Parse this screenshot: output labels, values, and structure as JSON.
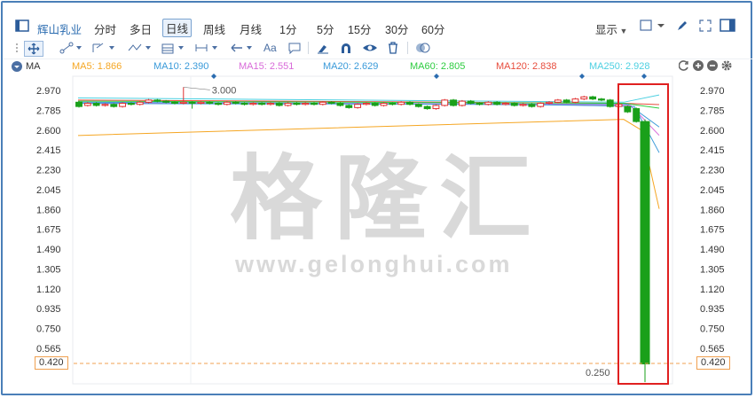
{
  "toolbar": {
    "stock_name": "辉山乳业",
    "periods": [
      "分时",
      "多日",
      "日线",
      "周线",
      "月线",
      "1分",
      "5分",
      "15分",
      "30分",
      "60分"
    ],
    "active_period": "日线",
    "display_label": "显示",
    "text_tool_label": "Aa"
  },
  "ma_bar": {
    "ma_label": "MA",
    "items": [
      {
        "label": "MA5: 1.866",
        "color": "#f5a623"
      },
      {
        "label": "MA10: 2.390",
        "color": "#3a9ad9"
      },
      {
        "label": "MA15: 2.551",
        "color": "#d96bd9"
      },
      {
        "label": "MA20: 2.629",
        "color": "#3a9ad9"
      },
      {
        "label": "MA60: 2.805",
        "color": "#2ecc40"
      },
      {
        "label": "MA120: 2.838",
        "color": "#e74c3c"
      },
      {
        "label": "MA250: 2.928",
        "color": "#4dd0e1"
      }
    ]
  },
  "watermark": {
    "brand": "格隆汇",
    "url": "www.gelonghui.com"
  },
  "chart_data": {
    "type": "candlestick",
    "y_ticks": [
      "2.970",
      "2.785",
      "2.600",
      "2.415",
      "2.230",
      "2.045",
      "1.860",
      "1.675",
      "1.490",
      "1.305",
      "1.120",
      "0.935",
      "0.750",
      "0.565"
    ],
    "ylim": [
      0.25,
      3.08
    ],
    "current_price": "0.420",
    "high_annotation": "3.000",
    "low_annotation": "0.250",
    "colors": {
      "up": "#e03030",
      "down": "#1aa01a"
    },
    "candles": [
      {
        "o": 2.86,
        "c": 2.82,
        "h": 2.87,
        "l": 2.81
      },
      {
        "o": 2.83,
        "c": 2.85,
        "h": 2.86,
        "l": 2.82
      },
      {
        "o": 2.85,
        "c": 2.83,
        "h": 2.86,
        "l": 2.82
      },
      {
        "o": 2.83,
        "c": 2.84,
        "h": 2.85,
        "l": 2.82
      },
      {
        "o": 2.84,
        "c": 2.82,
        "h": 2.85,
        "l": 2.81
      },
      {
        "o": 2.82,
        "c": 2.85,
        "h": 2.86,
        "l": 2.81
      },
      {
        "o": 2.85,
        "c": 2.84,
        "h": 2.86,
        "l": 2.83
      },
      {
        "o": 2.84,
        "c": 2.86,
        "h": 2.87,
        "l": 2.83
      },
      {
        "o": 2.86,
        "c": 2.88,
        "h": 2.89,
        "l": 2.85
      },
      {
        "o": 2.88,
        "c": 2.87,
        "h": 2.89,
        "l": 2.86
      },
      {
        "o": 2.87,
        "c": 2.86,
        "h": 2.88,
        "l": 2.85
      },
      {
        "o": 2.86,
        "c": 2.85,
        "h": 2.87,
        "l": 2.84
      },
      {
        "o": 2.85,
        "c": 2.86,
        "h": 3.0,
        "l": 2.84
      },
      {
        "o": 2.86,
        "c": 2.85,
        "h": 2.87,
        "l": 2.8
      },
      {
        "o": 2.85,
        "c": 2.86,
        "h": 2.87,
        "l": 2.84
      },
      {
        "o": 2.86,
        "c": 2.85,
        "h": 2.87,
        "l": 2.84
      },
      {
        "o": 2.85,
        "c": 2.84,
        "h": 2.86,
        "l": 2.83
      },
      {
        "o": 2.84,
        "c": 2.86,
        "h": 2.87,
        "l": 2.83
      },
      {
        "o": 2.86,
        "c": 2.85,
        "h": 2.87,
        "l": 2.84
      },
      {
        "o": 2.85,
        "c": 2.84,
        "h": 2.86,
        "l": 2.83
      },
      {
        "o": 2.84,
        "c": 2.85,
        "h": 2.86,
        "l": 2.83
      },
      {
        "o": 2.85,
        "c": 2.84,
        "h": 2.86,
        "l": 2.83
      },
      {
        "o": 2.84,
        "c": 2.85,
        "h": 2.86,
        "l": 2.83
      },
      {
        "o": 2.85,
        "c": 2.83,
        "h": 2.86,
        "l": 2.82
      },
      {
        "o": 2.83,
        "c": 2.85,
        "h": 2.86,
        "l": 2.82
      },
      {
        "o": 2.85,
        "c": 2.84,
        "h": 2.86,
        "l": 2.83
      },
      {
        "o": 2.84,
        "c": 2.85,
        "h": 2.86,
        "l": 2.83
      },
      {
        "o": 2.85,
        "c": 2.84,
        "h": 2.86,
        "l": 2.83
      },
      {
        "o": 2.84,
        "c": 2.86,
        "h": 2.87,
        "l": 2.83
      },
      {
        "o": 2.86,
        "c": 2.85,
        "h": 2.87,
        "l": 2.84
      },
      {
        "o": 2.85,
        "c": 2.83,
        "h": 2.86,
        "l": 2.82
      },
      {
        "o": 2.83,
        "c": 2.81,
        "h": 2.84,
        "l": 2.8
      },
      {
        "o": 2.81,
        "c": 2.84,
        "h": 2.85,
        "l": 2.8
      },
      {
        "o": 2.84,
        "c": 2.85,
        "h": 2.86,
        "l": 2.83
      },
      {
        "o": 2.85,
        "c": 2.83,
        "h": 2.86,
        "l": 2.82
      },
      {
        "o": 2.83,
        "c": 2.85,
        "h": 2.86,
        "l": 2.82
      },
      {
        "o": 2.85,
        "c": 2.84,
        "h": 2.86,
        "l": 2.83
      },
      {
        "o": 2.84,
        "c": 2.86,
        "h": 2.87,
        "l": 2.83
      },
      {
        "o": 2.86,
        "c": 2.84,
        "h": 2.87,
        "l": 2.83
      },
      {
        "o": 2.84,
        "c": 2.82,
        "h": 2.85,
        "l": 2.81
      },
      {
        "o": 2.82,
        "c": 2.8,
        "h": 2.83,
        "l": 2.79
      },
      {
        "o": 2.8,
        "c": 2.83,
        "h": 2.84,
        "l": 2.79
      },
      {
        "o": 2.83,
        "c": 2.88,
        "h": 2.89,
        "l": 2.82
      },
      {
        "o": 2.88,
        "c": 2.83,
        "h": 2.89,
        "l": 2.82
      },
      {
        "o": 2.83,
        "c": 2.87,
        "h": 2.88,
        "l": 2.82
      },
      {
        "o": 2.87,
        "c": 2.85,
        "h": 2.88,
        "l": 2.84
      },
      {
        "o": 2.85,
        "c": 2.84,
        "h": 2.86,
        "l": 2.83
      },
      {
        "o": 2.84,
        "c": 2.86,
        "h": 2.87,
        "l": 2.83
      },
      {
        "o": 2.86,
        "c": 2.84,
        "h": 2.87,
        "l": 2.83
      },
      {
        "o": 2.84,
        "c": 2.85,
        "h": 2.86,
        "l": 2.83
      },
      {
        "o": 2.85,
        "c": 2.83,
        "h": 2.86,
        "l": 2.82
      },
      {
        "o": 2.83,
        "c": 2.84,
        "h": 2.85,
        "l": 2.82
      },
      {
        "o": 2.84,
        "c": 2.82,
        "h": 2.85,
        "l": 2.81
      },
      {
        "o": 2.82,
        "c": 2.85,
        "h": 2.86,
        "l": 2.81
      },
      {
        "o": 2.85,
        "c": 2.86,
        "h": 2.87,
        "l": 2.84
      },
      {
        "o": 2.86,
        "c": 2.88,
        "h": 2.89,
        "l": 2.85
      },
      {
        "o": 2.88,
        "c": 2.86,
        "h": 2.89,
        "l": 2.85
      },
      {
        "o": 2.86,
        "c": 2.89,
        "h": 2.9,
        "l": 2.85
      },
      {
        "o": 2.89,
        "c": 2.91,
        "h": 2.92,
        "l": 2.88
      },
      {
        "o": 2.91,
        "c": 2.89,
        "h": 2.92,
        "l": 2.88
      },
      {
        "o": 2.89,
        "c": 2.88,
        "h": 2.9,
        "l": 2.87
      },
      {
        "o": 2.88,
        "c": 2.82,
        "h": 2.89,
        "l": 2.81
      },
      {
        "o": 2.82,
        "c": 2.84,
        "h": 2.85,
        "l": 2.8
      },
      {
        "o": 2.82,
        "c": 2.77,
        "h": 2.83,
        "l": 2.76
      },
      {
        "o": 2.8,
        "c": 2.68,
        "h": 2.81,
        "l": 2.67
      },
      {
        "o": 2.68,
        "c": 0.42,
        "h": 2.7,
        "l": 0.25
      }
    ],
    "ma_lines": [
      {
        "name": "MA5",
        "color": "#f5a623",
        "values": {
          "start": 2.55,
          "mid": 2.7,
          "end": 1.866
        }
      },
      {
        "name": "MA10",
        "color": "#3a9ad9",
        "end": 2.39
      },
      {
        "name": "MA15",
        "color": "#d96bd9",
        "end": 2.551
      },
      {
        "name": "MA20",
        "color": "#3a9ad9",
        "end": 2.629
      },
      {
        "name": "MA60",
        "color": "#2ecc40",
        "end": 2.805
      },
      {
        "name": "MA120",
        "color": "#e74c3c",
        "end": 2.838
      },
      {
        "name": "MA250",
        "color": "#4dd0e1",
        "end": 2.928
      }
    ]
  }
}
